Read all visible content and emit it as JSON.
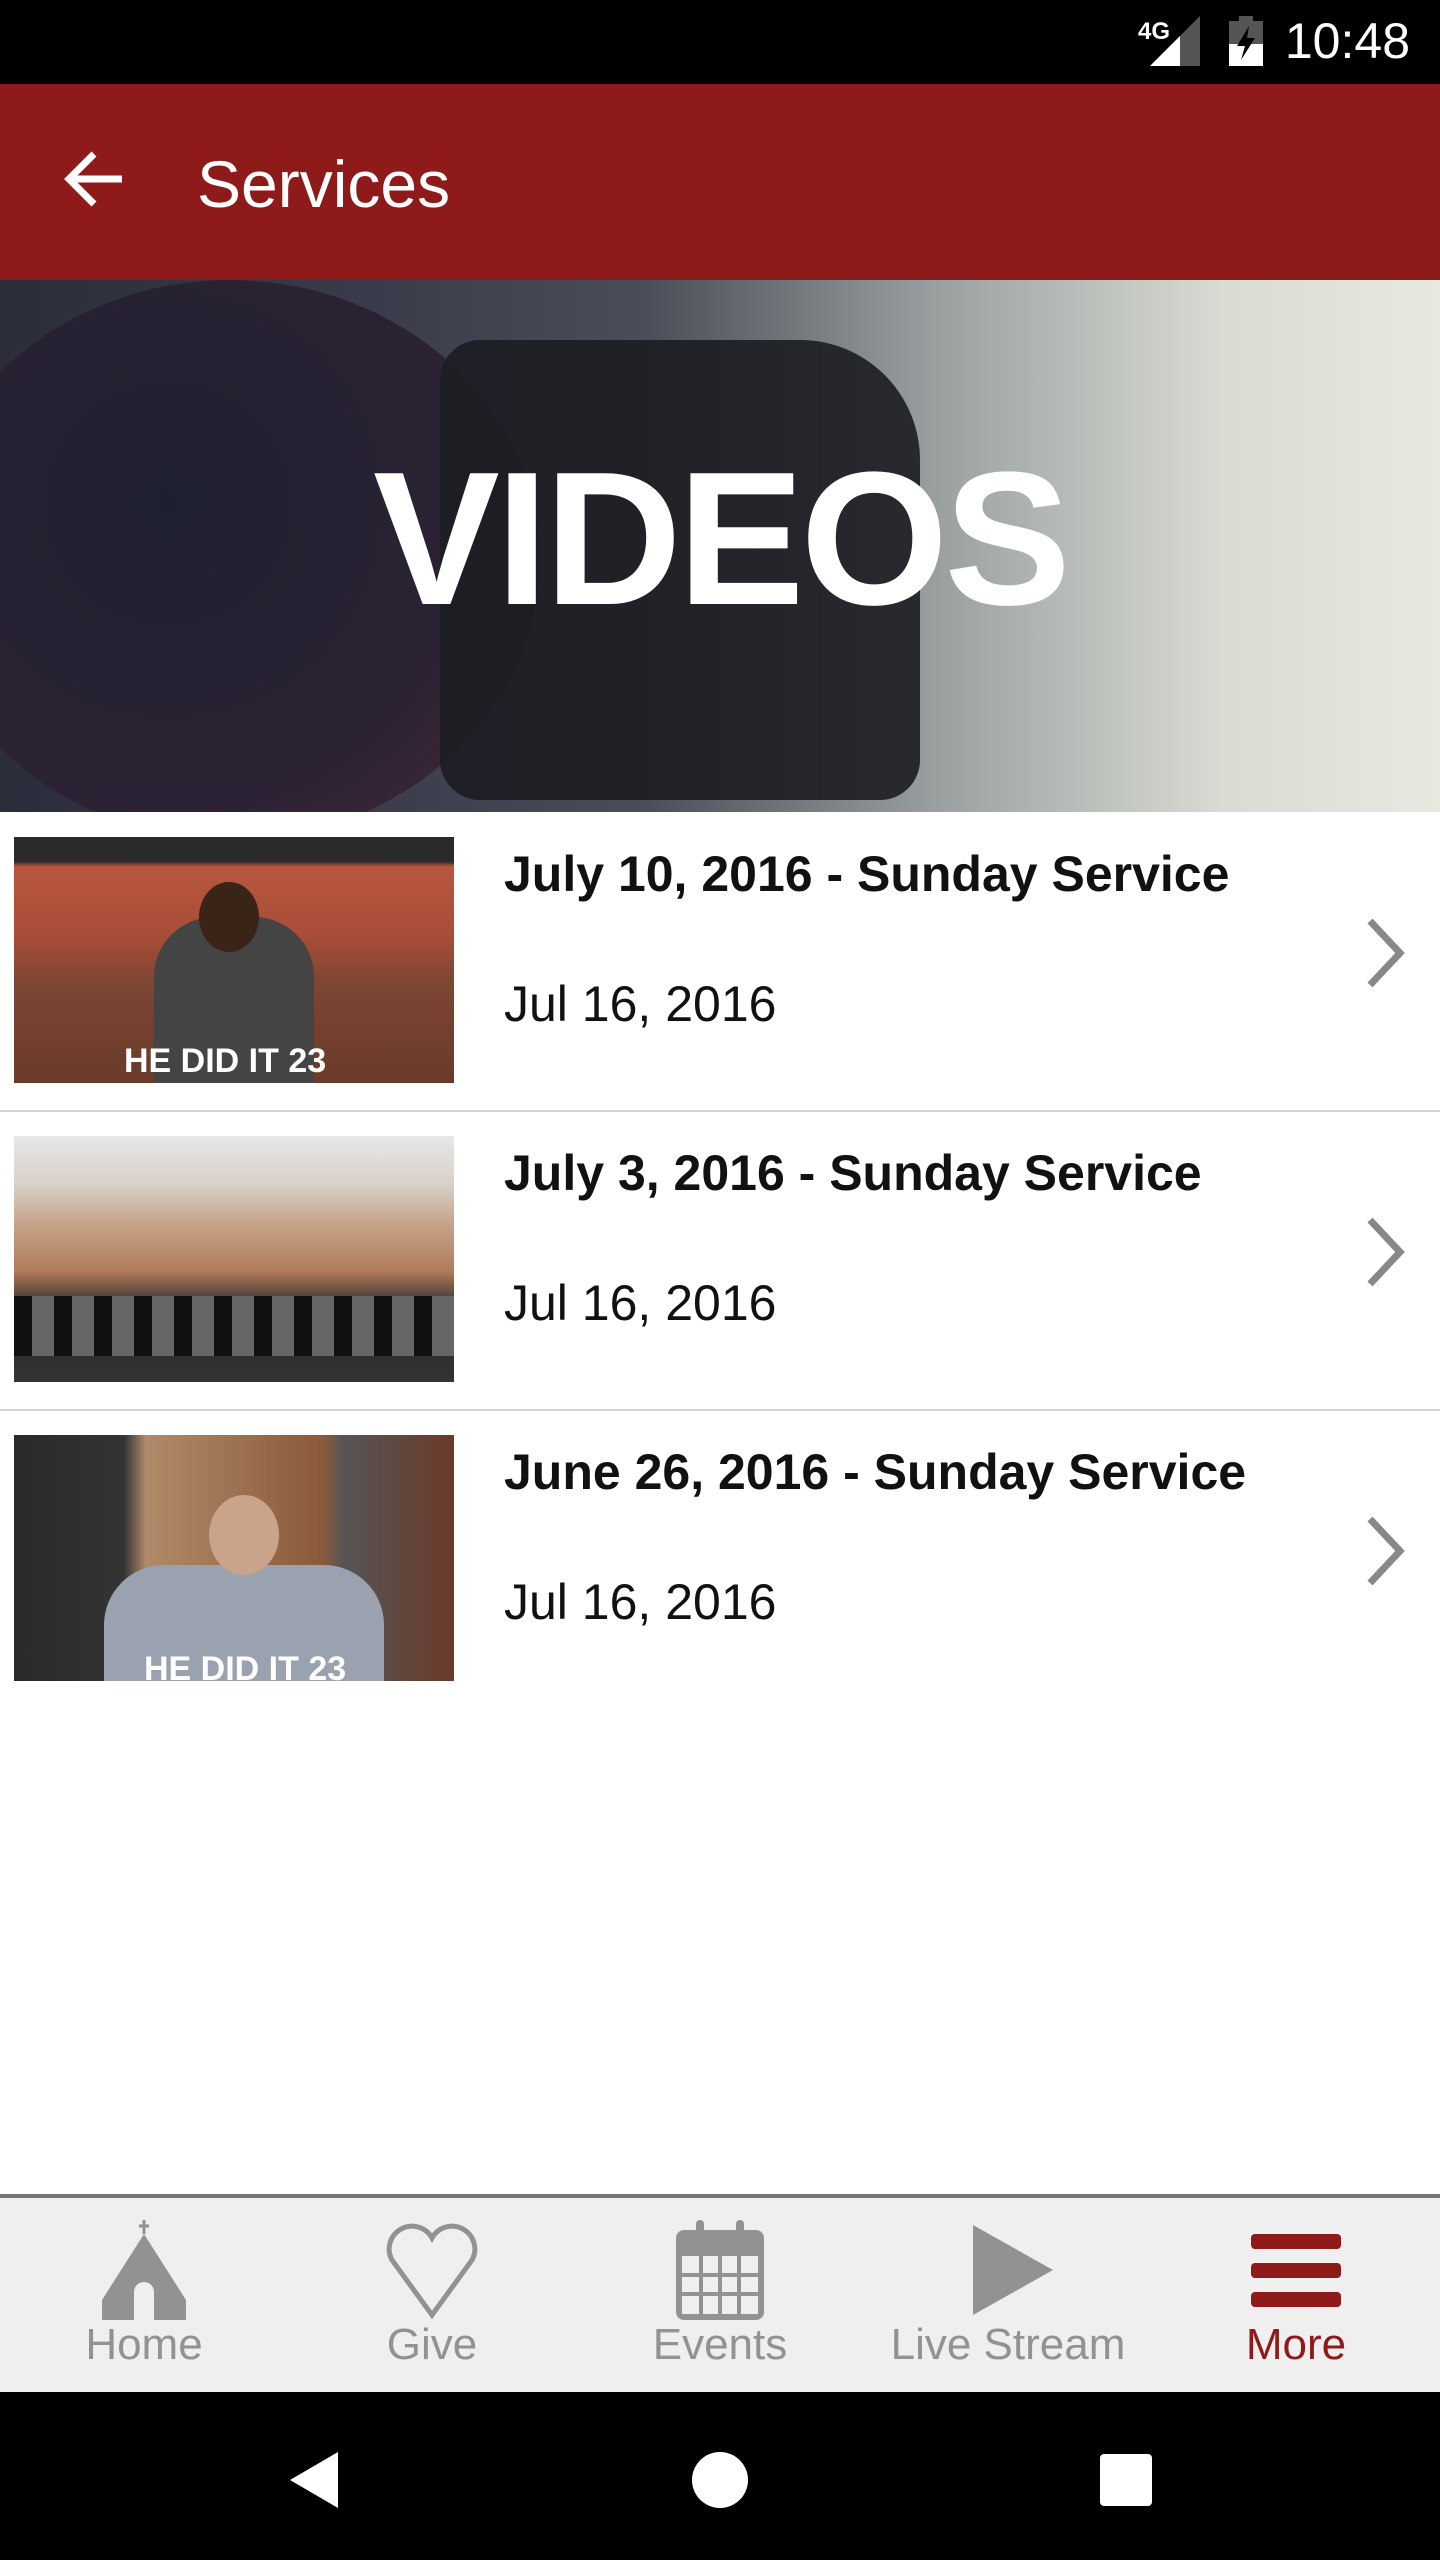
{
  "status_bar": {
    "network": "4G",
    "time": "10:48",
    "battery_icon": "battery-charging-icon"
  },
  "app_bar": {
    "title": "Services",
    "back_icon": "arrow-left-icon"
  },
  "banner": {
    "text": "VIDEOS"
  },
  "videos": [
    {
      "title": "July 10, 2016 - Sunday Service",
      "date": "Jul 16, 2016",
      "thumb_caption": "HE DID IT 23"
    },
    {
      "title": "July 3, 2016 - Sunday Service",
      "date": "Jul 16, 2016"
    },
    {
      "title": "June 26, 2016 - Sunday Service",
      "date": "Jul 16, 2016",
      "thumb_caption": "HE DID IT 23"
    }
  ],
  "bottom_nav": {
    "items": [
      {
        "label": "Home",
        "icon": "church-icon"
      },
      {
        "label": "Give",
        "icon": "heart-icon"
      },
      {
        "label": "Events",
        "icon": "calendar-icon"
      },
      {
        "label": "Live Stream",
        "icon": "play-icon"
      },
      {
        "label": "More",
        "icon": "menu-icon",
        "active": true
      }
    ]
  },
  "colors": {
    "brand": "#8f1a1a",
    "inactive": "#929292",
    "nav_bg": "#efefef"
  }
}
